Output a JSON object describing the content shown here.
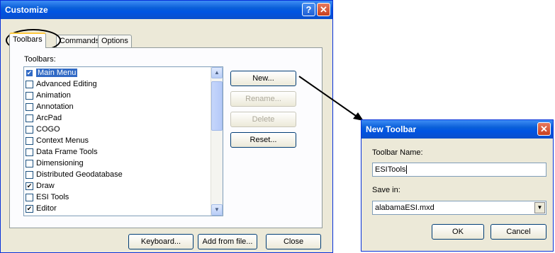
{
  "customize": {
    "title": "Customize",
    "help_glyph": "?",
    "close_glyph": "✕",
    "tabs": [
      {
        "label": "Toolbars",
        "active": true
      },
      {
        "label": "Commands",
        "active": false
      },
      {
        "label": "Options",
        "active": false
      }
    ],
    "toolbars_label": "Toolbars:",
    "toolbars": [
      {
        "label": "Main Menu",
        "checked": true,
        "selected": true
      },
      {
        "label": "Advanced Editing",
        "checked": false
      },
      {
        "label": "Animation",
        "checked": false
      },
      {
        "label": "Annotation",
        "checked": false
      },
      {
        "label": "ArcPad",
        "checked": false
      },
      {
        "label": "COGO",
        "checked": false
      },
      {
        "label": "Context Menus",
        "checked": false
      },
      {
        "label": "Data Frame Tools",
        "checked": false
      },
      {
        "label": "Dimensioning",
        "checked": false
      },
      {
        "label": "Distributed Geodatabase",
        "checked": false
      },
      {
        "label": "Draw",
        "checked": true
      },
      {
        "label": "ESI Tools",
        "checked": false
      },
      {
        "label": "Editor",
        "checked": true
      }
    ],
    "buttons": {
      "new": "New...",
      "rename": "Rename...",
      "delete": "Delete",
      "reset": "Reset...",
      "keyboard": "Keyboard...",
      "add_from_file": "Add from file...",
      "close": "Close"
    },
    "scroll_up_glyph": "▲",
    "scroll_down_glyph": "▼"
  },
  "new_toolbar": {
    "title": "New Toolbar",
    "close_glyph": "✕",
    "name_label": "Toolbar Name:",
    "name_value": "ESITools",
    "save_label": "Save in:",
    "save_value": "alabamaESI.mxd",
    "dropdown_glyph": "▼",
    "ok": "OK",
    "cancel": "Cancel"
  },
  "colors": {
    "titlebar": "#0054e3",
    "dialog_bg": "#ece9d8",
    "selection": "#316ac5"
  }
}
